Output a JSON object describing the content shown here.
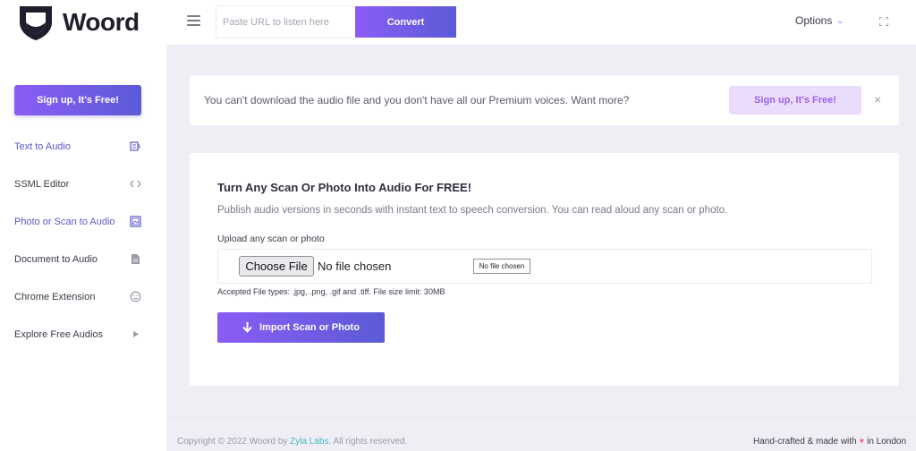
{
  "brand": {
    "name": "Woord"
  },
  "sidebar": {
    "cta_label": "Sign up, It's Free!",
    "items": [
      {
        "label": "Text to Audio",
        "icon": "text-to-audio-icon",
        "active": true
      },
      {
        "label": "SSML Editor",
        "icon": "code-icon",
        "active": false
      },
      {
        "label": "Photo or Scan to Audio",
        "icon": "image-icon",
        "active": true
      },
      {
        "label": "Document to Audio",
        "icon": "document-icon",
        "active": false
      },
      {
        "label": "Chrome Extension",
        "icon": "smiley-icon",
        "active": false
      },
      {
        "label": "Explore Free Audios",
        "icon": "play-icon",
        "active": false
      }
    ]
  },
  "topbar": {
    "url_placeholder": "Paste URL to listen here",
    "convert_label": "Convert",
    "options_label": "Options"
  },
  "banner": {
    "text": "You can't download the audio file and you don't have all our Premium voices. Want more?",
    "cta_label": "Sign up, It's Free!",
    "close_glyph": "×"
  },
  "card": {
    "title": "Turn Any Scan Or Photo Into Audio For FREE!",
    "subtitle": "Publish audio versions in seconds with instant text to speech conversion. You can read aloud any scan or photo.",
    "upload_label": "Upload any scan or photo",
    "choose_file_label": "Choose File",
    "no_file_text": "No file chosen",
    "no_file_small": "No file chosen",
    "accepted_text": "Accepted File types: .jpg, .png, .gif and .tiff. File size limit: 30MB",
    "import_label": "Import Scan or Photo"
  },
  "footer": {
    "copyright_prefix": "Copyright © 2022 Woord by ",
    "company": "Zyla Labs",
    "copyright_suffix": ". All rights reserved.",
    "made_prefix": "Hand-crafted & made with ",
    "made_suffix": " in London"
  },
  "colors": {
    "accent": "#8b5cf6",
    "accent_end": "#5b5bd6",
    "link": "#3fb5c8",
    "heart": "#f07a9a"
  }
}
